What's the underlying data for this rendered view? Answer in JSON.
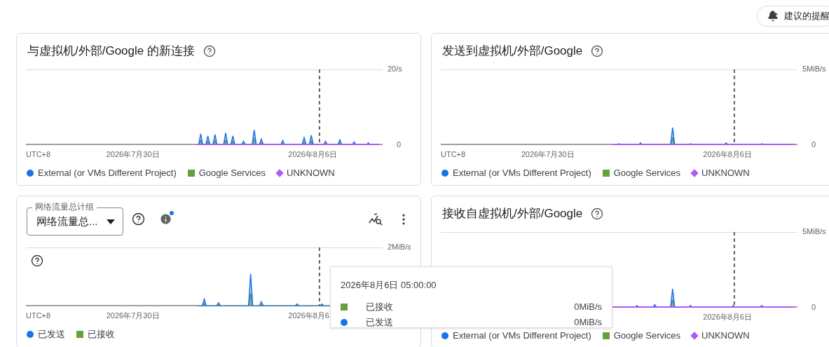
{
  "header": {
    "button": "建议的提醒"
  },
  "cards": [
    {
      "kind": "titled",
      "title": "与虚拟机/外部/Google 的新连接",
      "y_top": "20/s",
      "y_zero": "0",
      "x_labels": [
        "UTC+8",
        "2026年7月30日",
        "2026年8月6日"
      ],
      "legend": [
        {
          "label": "External (or VMs Different Project)",
          "kind": "circle",
          "color": "#1a73e8"
        },
        {
          "label": "Google Services",
          "kind": "square",
          "color": "#65a13b"
        },
        {
          "label": "UNKNOWN",
          "kind": "diamond",
          "color": "#a95cf5"
        }
      ]
    },
    {
      "kind": "titled",
      "title": "发送到虚拟机/外部/Google",
      "y_top": "5MiB/s",
      "y_zero": "0",
      "x_labels": [
        "UTC+8",
        "2026年7月30日",
        "2026年8月6日"
      ],
      "legend": [
        {
          "label": "External (or VMs Different Project)",
          "kind": "circle",
          "color": "#1a73e8"
        },
        {
          "label": "Google Services",
          "kind": "square",
          "color": "#65a13b"
        },
        {
          "label": "UNKNOWN",
          "kind": "diamond",
          "color": "#a95cf5"
        }
      ]
    },
    {
      "kind": "selector",
      "select": {
        "label": "网络流量总计组",
        "value": "网络流量总..."
      },
      "y_top": "2MiB/s",
      "x_labels": [
        "UTC+8",
        "2026年7月30日",
        "2026年8月6"
      ],
      "legend": [
        {
          "label": "已发送",
          "kind": "circle",
          "color": "#1a73e8"
        },
        {
          "label": "已接收",
          "kind": "square",
          "color": "#65a13b"
        }
      ]
    },
    {
      "kind": "titled",
      "title": "接收自虚拟机/外部/Google",
      "y_top": "5MiB/s",
      "y_zero": "0",
      "x_labels": [
        "2026年8月6日"
      ],
      "legend": [
        {
          "label": "External (or VMs Different Project)",
          "kind": "circle",
          "color": "#1a73e8"
        },
        {
          "label": "Google Services",
          "kind": "square",
          "color": "#65a13b"
        },
        {
          "label": "UNKNOWN",
          "kind": "diamond",
          "color": "#a95cf5"
        }
      ]
    }
  ],
  "tooltip": {
    "title": "2026年8月6日 05:00:00",
    "rows": [
      {
        "label": "已接收",
        "value": "0MiB/s",
        "kind": "square",
        "color": "#65a13b"
      },
      {
        "label": "已发送",
        "value": "0MiB/s",
        "kind": "circle",
        "color": "#1a73e8"
      }
    ]
  }
}
